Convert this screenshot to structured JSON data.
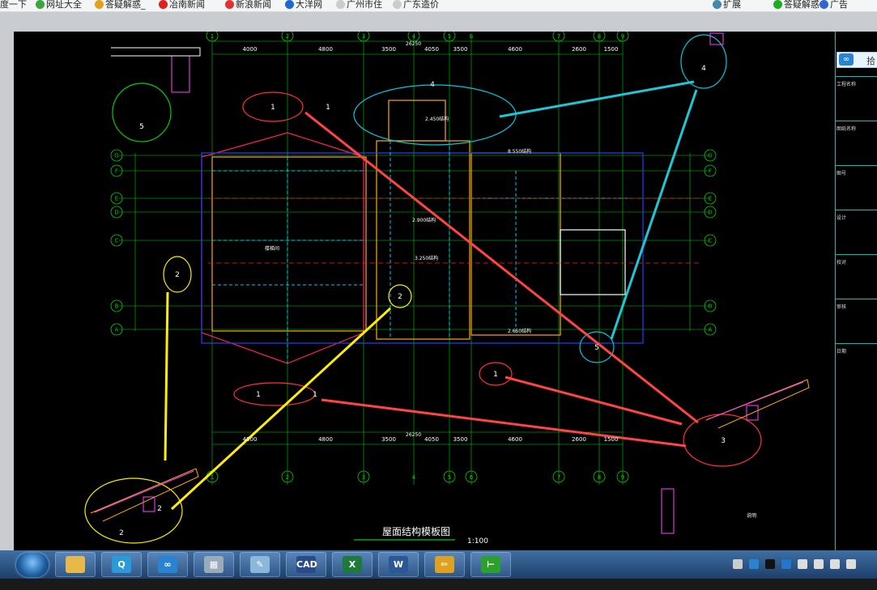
{
  "bookmarks": [
    {
      "label": "度一下",
      "icon": "none"
    },
    {
      "label": "网址大全",
      "icon": "green-plus-icon"
    },
    {
      "label": "答疑解惑_",
      "icon": "swirl-icon"
    },
    {
      "label": "冶南新闻",
      "icon": "red-news-icon"
    },
    {
      "label": "新浪新闻",
      "icon": "sina-eye-icon"
    },
    {
      "label": "大洋网",
      "icon": "blue-circle-icon"
    },
    {
      "label": "广州市住",
      "icon": "page-icon"
    },
    {
      "label": "广东造价",
      "icon": "page-icon"
    }
  ],
  "bookmarks_right": [
    {
      "label": "扩展",
      "icon": "grid-icon"
    },
    {
      "label": "答疑解惑",
      "icon": "green-circle-icon"
    },
    {
      "label": "广告",
      "icon": "blue-e-icon"
    }
  ],
  "drawing": {
    "title": "屋面结构模板图",
    "scale": "1:100",
    "total_dim": "26250",
    "col_dims": [
      "4000",
      "4800",
      "3500",
      "4050",
      "3500",
      "4600",
      "2600",
      "1500"
    ],
    "col_labels": [
      "1",
      "2",
      "3",
      "4",
      "5",
      "6",
      "7",
      "8",
      "9"
    ],
    "row_labels": [
      "G",
      "F",
      "E",
      "D",
      "C",
      "B",
      "A"
    ],
    "callouts": [
      "1",
      "2",
      "3",
      "4",
      "5"
    ],
    "floor_label": "楼梯间",
    "elev_labels": [
      "2.450结构",
      "2.900结构",
      "3.250结构",
      "8.550结构",
      "2.650结构"
    ],
    "note_label": "说明"
  },
  "sidepanel": {
    "sign_btn": "拾",
    "rows": [
      "工程名称",
      "图纸名称",
      "图号",
      "设计",
      "校对",
      "审核",
      "日期"
    ]
  },
  "taskbar": {
    "apps": [
      {
        "name": "explorer",
        "icon": "folder-icon",
        "glyph": ""
      },
      {
        "name": "browser",
        "icon": "q-browser-icon",
        "glyph": "Q"
      },
      {
        "name": "baidu-cloud",
        "icon": "cloud-icon",
        "glyph": "∞"
      },
      {
        "name": "calculator",
        "icon": "calculator-icon",
        "glyph": "▦"
      },
      {
        "name": "notepad",
        "icon": "notepad-icon",
        "glyph": "✎"
      },
      {
        "name": "cad",
        "icon": "cad-icon",
        "glyph": "CAD"
      },
      {
        "name": "excel",
        "icon": "excel-icon",
        "glyph": "X"
      },
      {
        "name": "word",
        "icon": "word-icon",
        "glyph": "W"
      },
      {
        "name": "sketch",
        "icon": "sketch-icon",
        "glyph": "✏"
      },
      {
        "name": "glodon",
        "icon": "glodon-icon",
        "glyph": "⊢"
      }
    ],
    "colors": {
      "excel": "#1f7a3a",
      "word": "#2b5797",
      "cad": "#2a4a8a",
      "glodon": "#2ca02c",
      "sketch": "#e0a020"
    }
  }
}
